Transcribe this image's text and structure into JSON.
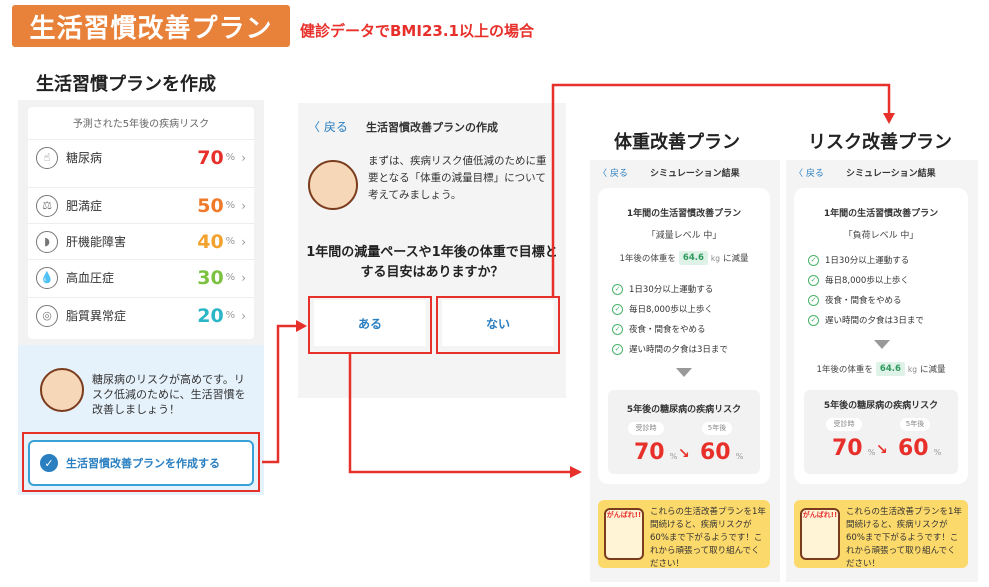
{
  "header": {
    "title": "生活習慣改善プラン",
    "subtitle": "健診データでBMI23.1以上の場合"
  },
  "panel1": {
    "section_title": "生活習慣プランを作成",
    "risk_header": "予測された5年後の疾病リスク",
    "risks": [
      {
        "name": "糖尿病",
        "value": "70",
        "unit": "%",
        "color": "#e8302b",
        "icon": "finger-pointing-icon"
      },
      {
        "name": "肥満症",
        "value": "50",
        "unit": "%",
        "color": "#f07a2a",
        "icon": "scale-icon"
      },
      {
        "name": "肝機能障害",
        "value": "40",
        "unit": "%",
        "color": "#f2a22c",
        "icon": "liver-icon"
      },
      {
        "name": "高血圧症",
        "value": "30",
        "unit": "%",
        "color": "#7cc142",
        "icon": "drops-icon"
      },
      {
        "name": "脂質異常症",
        "value": "20",
        "unit": "%",
        "color": "#2bb6c7",
        "icon": "fat-icon"
      }
    ],
    "chevron": "›",
    "advice": "糖尿病のリスクが高めです。リスク低減のために、生活習慣を改善しましょう！",
    "create_button": "生活習慣改善プランを作成する"
  },
  "panel2": {
    "back": "〈 戻る",
    "title": "生活習慣改善プランの作成",
    "intro": "まずは、疾病リスク値低減のために重要となる「体重の減量目標」について考えてみましょう。",
    "question": "1年間の減量ペースや1年後の体重で目標とする目安はありますか？",
    "yes": "ある",
    "no": "ない"
  },
  "panel3": {
    "section_title": "体重改善プラン",
    "back": "〈 戻る",
    "nav_title": "シミュレーション結果",
    "card_title": "1年間の生活習慣改善プラン",
    "level": "「減量レベル 中」",
    "weight_prefix": "1年後の体重を",
    "weight_value": "64.6",
    "weight_unit": "kg",
    "weight_suffix": "に減量",
    "items": [
      "1日30分以上運動する",
      "毎日8,000歩以上歩く",
      "夜食・間食をやめる",
      "遅い時間の夕食は3日まで"
    ],
    "risk_title": "5年後の糖尿病の疾病リスク",
    "before_label": "受診時",
    "after_label": "5年後",
    "before_value": "70",
    "after_value": "60",
    "unit": "%",
    "cheer_badge": "がんばれ!!",
    "cheer": "これらの生活改善プランを1年間続けると、疾病リスクが60%まで下がるようです！これから頑張って取り組んでください！"
  },
  "panel4": {
    "section_title": "リスク改善プラン",
    "back": "〈 戻る",
    "nav_title": "シミュレーション結果",
    "card_title": "1年間の生活習慣改善プラン",
    "level": "「負荷レベル 中」",
    "weight_prefix": "1年後の体重を",
    "weight_value": "64.6",
    "weight_unit": "kg",
    "weight_suffix": "に減量",
    "items": [
      "1日30分以上運動する",
      "毎日8,000歩以上歩く",
      "夜食・間食をやめる",
      "遅い時間の夕食は3日まで"
    ],
    "risk_title": "5年後の糖尿病の疾病リスク",
    "before_label": "受診時",
    "after_label": "5年後",
    "before_value": "70",
    "after_value": "60",
    "unit": "%",
    "cheer_badge": "がんばれ!!",
    "cheer": "これらの生活改善プランを1年間続けると、疾病リスクが60%まで下がるようです！これから頑張って取り組んでください！"
  },
  "colors": {
    "accent": "#e8813a",
    "highlight": "#e8302b",
    "link": "#2a7fc1"
  }
}
